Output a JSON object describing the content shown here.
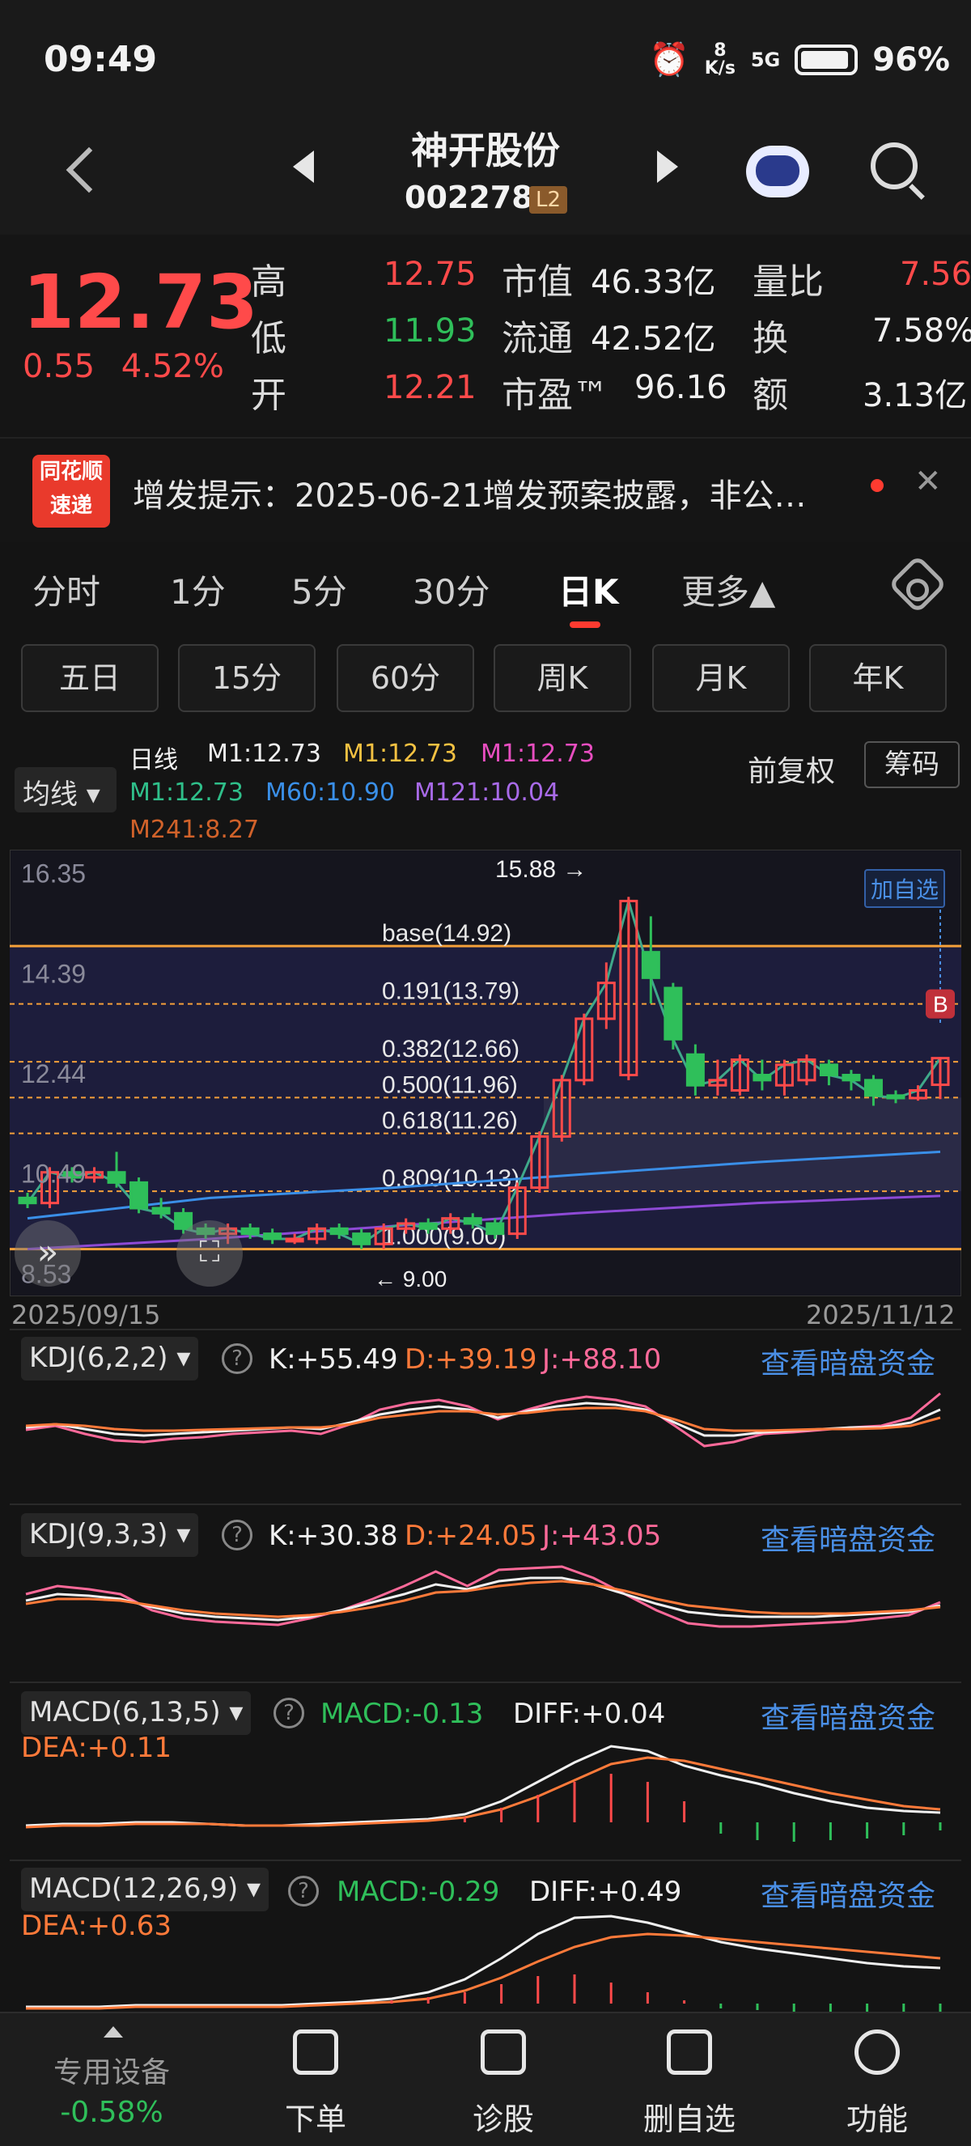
{
  "status": {
    "time": "09:49",
    "net_speed": "8 K/s",
    "signal": "5G",
    "battery": "96%"
  },
  "header": {
    "stock_name": "神开股份",
    "stock_code": "002278",
    "level_badge": "L2"
  },
  "quote": {
    "price": "12.73",
    "change": "0.55",
    "change_pct": "4.52%",
    "rows": [
      {
        "l1": "高",
        "v1": "12.75",
        "l2": "市值",
        "v2": "46.33亿",
        "l3": "量比",
        "v3": "7.56"
      },
      {
        "l1": "低",
        "v1": "11.93",
        "l2": "流通",
        "v2": "42.52亿",
        "l3": "换",
        "v3": "7.58%"
      },
      {
        "l1": "开",
        "v1": "12.21",
        "l2": "市盈™",
        "v2": "96.16",
        "l3": "额",
        "v3": "3.13亿"
      }
    ]
  },
  "notice": {
    "logo_line1": "同花顺",
    "logo_line2": "速递",
    "text": "增发提示：2025-06-21增发预案披露，非公…"
  },
  "tabs": [
    "分时",
    "1分",
    "5分",
    "30分",
    "日K",
    "更多▲"
  ],
  "active_tab": "日K",
  "periods": [
    "五日",
    "15分",
    "60分",
    "周K",
    "月K",
    "年K"
  ],
  "ma": {
    "selector": "均线 ▾",
    "line_label": "日线",
    "m1a": "M1:12.73",
    "m1b": "M1:12.73",
    "m1c": "M1:12.73",
    "m1d": "M1:12.73",
    "m60": "M60:10.90",
    "m121": "M121:10.04",
    "m241": "M241:8.27",
    "adj": "前复权",
    "chips": "筹码"
  },
  "kchart": {
    "y_ticks": [
      "16.35",
      "14.39",
      "12.44",
      "10.49",
      "8.53"
    ],
    "high_label": "15.88",
    "low_label": "9.00",
    "fib": [
      {
        "label": "base(14.92)",
        "value": 14.92
      },
      {
        "label": "0.191(13.79)",
        "value": 13.79
      },
      {
        "label": "0.382(12.66)",
        "value": 12.66
      },
      {
        "label": "0.500(11.96)",
        "value": 11.96
      },
      {
        "label": "0.618(11.26)",
        "value": 11.26
      },
      {
        "label": "0.809(10.13)",
        "value": 10.13
      },
      {
        "label": "1.000(9.00)",
        "value": 9.0
      }
    ],
    "add_watch": "加自选",
    "buy_marker": "B",
    "date_start": "2025/09/15",
    "date_end": "2025/11/12"
  },
  "chart_data": {
    "type": "candlestick",
    "ylim": [
      8.33,
      16.55
    ],
    "candles": [
      {
        "o": 10.0,
        "c": 9.9,
        "h": 10.1,
        "l": 9.8
      },
      {
        "o": 9.9,
        "c": 10.5,
        "h": 10.6,
        "l": 9.8
      },
      {
        "o": 10.5,
        "c": 10.4,
        "h": 10.6,
        "l": 10.3
      },
      {
        "o": 10.4,
        "c": 10.5,
        "h": 10.6,
        "l": 10.3
      },
      {
        "o": 10.5,
        "c": 10.3,
        "h": 10.9,
        "l": 10.2
      },
      {
        "o": 10.3,
        "c": 9.8,
        "h": 10.4,
        "l": 9.7
      },
      {
        "o": 9.8,
        "c": 9.7,
        "h": 10.0,
        "l": 9.6
      },
      {
        "o": 9.7,
        "c": 9.4,
        "h": 9.8,
        "l": 9.3
      },
      {
        "o": 9.4,
        "c": 9.3,
        "h": 9.5,
        "l": 9.2
      },
      {
        "o": 9.3,
        "c": 9.4,
        "h": 9.5,
        "l": 9.1
      },
      {
        "o": 9.4,
        "c": 9.3,
        "h": 9.5,
        "l": 9.2
      },
      {
        "o": 9.3,
        "c": 9.2,
        "h": 9.4,
        "l": 9.1
      },
      {
        "o": 9.2,
        "c": 9.2,
        "h": 9.3,
        "l": 9.1
      },
      {
        "o": 9.2,
        "c": 9.4,
        "h": 9.5,
        "l": 9.1
      },
      {
        "o": 9.4,
        "c": 9.3,
        "h": 9.5,
        "l": 9.2
      },
      {
        "o": 9.3,
        "c": 9.1,
        "h": 9.4,
        "l": 9.0
      },
      {
        "o": 9.1,
        "c": 9.4,
        "h": 9.5,
        "l": 9.0
      },
      {
        "o": 9.4,
        "c": 9.5,
        "h": 9.6,
        "l": 9.3
      },
      {
        "o": 9.5,
        "c": 9.4,
        "h": 9.6,
        "l": 9.3
      },
      {
        "o": 9.4,
        "c": 9.6,
        "h": 9.7,
        "l": 9.3
      },
      {
        "o": 9.6,
        "c": 9.5,
        "h": 9.7,
        "l": 9.4
      },
      {
        "o": 9.5,
        "c": 9.3,
        "h": 9.6,
        "l": 9.2
      },
      {
        "o": 9.3,
        "c": 10.2,
        "h": 10.3,
        "l": 9.2
      },
      {
        "o": 10.2,
        "c": 11.2,
        "h": 11.3,
        "l": 10.1
      },
      {
        "o": 11.2,
        "c": 12.3,
        "h": 12.4,
        "l": 11.1
      },
      {
        "o": 12.3,
        "c": 13.5,
        "h": 13.6,
        "l": 12.2
      },
      {
        "o": 13.5,
        "c": 14.2,
        "h": 14.6,
        "l": 13.3
      },
      {
        "o": 12.4,
        "c": 15.8,
        "h": 15.88,
        "l": 12.3
      },
      {
        "o": 14.8,
        "c": 14.3,
        "h": 15.5,
        "l": 13.8
      },
      {
        "o": 14.1,
        "c": 13.1,
        "h": 14.2,
        "l": 12.9
      },
      {
        "o": 12.8,
        "c": 12.2,
        "h": 13.0,
        "l": 12.0
      },
      {
        "o": 12.2,
        "c": 12.3,
        "h": 12.7,
        "l": 12.0
      },
      {
        "o": 12.1,
        "c": 12.7,
        "h": 12.8,
        "l": 12.0
      },
      {
        "o": 12.4,
        "c": 12.3,
        "h": 12.7,
        "l": 12.1
      },
      {
        "o": 12.2,
        "c": 12.6,
        "h": 12.7,
        "l": 12.0
      },
      {
        "o": 12.3,
        "c": 12.7,
        "h": 12.8,
        "l": 12.2
      },
      {
        "o": 12.6,
        "c": 12.4,
        "h": 12.7,
        "l": 12.2
      },
      {
        "o": 12.4,
        "c": 12.3,
        "h": 12.5,
        "l": 12.1
      },
      {
        "o": 12.3,
        "c": 12.0,
        "h": 12.4,
        "l": 11.8
      },
      {
        "o": 12.0,
        "c": 11.95,
        "h": 12.1,
        "l": 11.85
      },
      {
        "o": 11.95,
        "c": 12.1,
        "h": 12.2,
        "l": 11.9
      },
      {
        "o": 12.21,
        "c": 12.73,
        "h": 12.75,
        "l": 11.93
      }
    ],
    "ma60": [
      9.6,
      10.0,
      10.2,
      10.45,
      10.7,
      10.9
    ],
    "ma121": [
      9.0,
      9.2,
      9.45,
      9.7,
      9.9,
      10.04
    ]
  },
  "kdj1": {
    "selector": "KDJ(6,2,2) ▾",
    "k": "K:+55.49",
    "d": "D:+39.19",
    "j": "J:+88.10",
    "link": "查看暗盘资金"
  },
  "kdj2": {
    "selector": "KDJ(9,3,3) ▾",
    "k": "K:+30.38",
    "d": "D:+24.05",
    "j": "J:+43.05",
    "link": "查看暗盘资金"
  },
  "macd1": {
    "selector": "MACD(6,13,5) ▾",
    "macd": "MACD:-0.13",
    "diff": "DIFF:+0.04",
    "dea": "DEA:+0.11",
    "link": "查看暗盘资金"
  },
  "macd2": {
    "selector": "MACD(12,26,9) ▾",
    "macd": "MACD:-0.29",
    "diff": "DIFF:+0.49",
    "dea": "DEA:+0.63",
    "link": "查看暗盘资金"
  },
  "bottom": {
    "device": "专用设备",
    "device_chg": "-0.58%",
    "order": "下单",
    "diagnose": "诊股",
    "del_watch": "删自选",
    "func": "功能"
  },
  "colors": {
    "up": "#ff4a4a",
    "down": "#2fbf5a",
    "fib": "#f5a03a",
    "ma60": "#3a8fe8",
    "ma121": "#8e4ad6"
  }
}
